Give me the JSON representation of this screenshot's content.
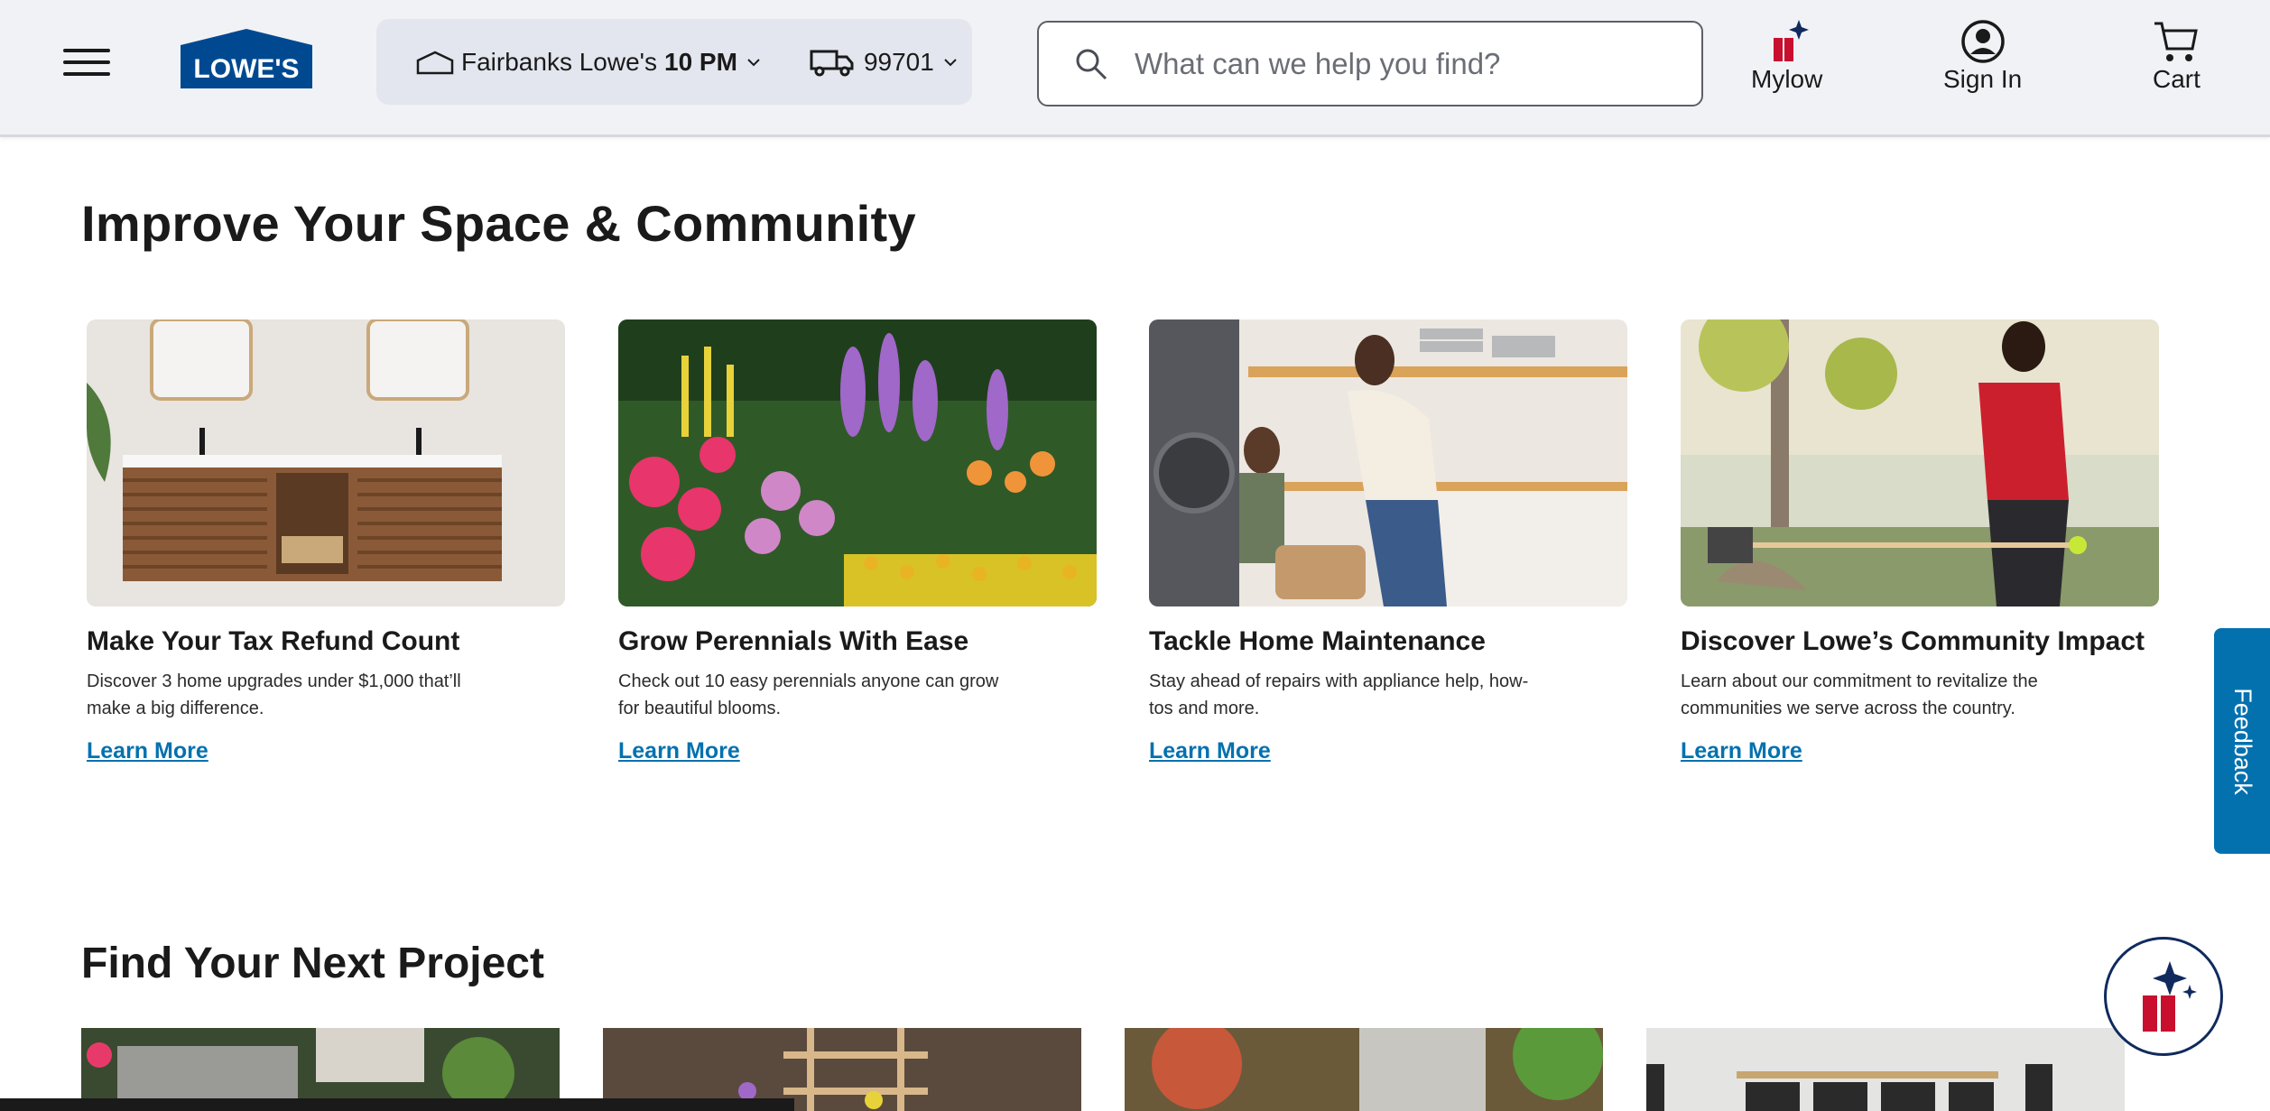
{
  "header": {
    "logo_text": "LOWE'S",
    "store_name": "Fairbanks Lowe's",
    "store_hours": "10 PM",
    "zip": "99701",
    "search_placeholder": "What can we help you find?",
    "mylow_label": "Mylow",
    "signin_label": "Sign In",
    "cart_label": "Cart"
  },
  "section1": {
    "title": "Improve Your Space & Community",
    "cards": [
      {
        "title": "Make Your Tax Refund Count",
        "desc": "Discover 3 home upgrades under $1,000 that’ll make a big difference.",
        "link": "Learn More"
      },
      {
        "title": "Grow Perennials With Ease",
        "desc": "Check out 10 easy perennials anyone can grow for beautiful blooms.",
        "link": "Learn More"
      },
      {
        "title": "Tackle Home Maintenance",
        "desc": "Stay ahead of repairs with appliance help, how-tos and more.",
        "link": "Learn More"
      },
      {
        "title": "Discover Lowe’s Community Impact",
        "desc": "Learn about our commitment to revitalize the communities we serve across the country.",
        "link": "Learn More"
      }
    ]
  },
  "section2": {
    "title": "Find Your Next Project"
  },
  "feedback_label": "Feedback",
  "colors": {
    "brand_blue": "#004990",
    "link_blue": "#0471af",
    "header_bg": "#f1f2f6"
  }
}
